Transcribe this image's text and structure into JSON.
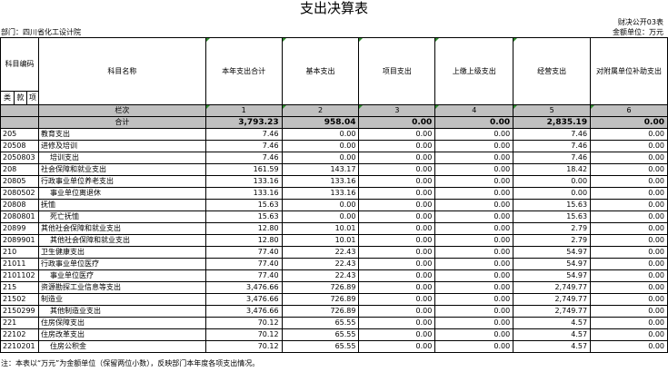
{
  "title": "支出决算表",
  "form_code": "财决公开03表",
  "unit": "金额单位：万元",
  "department": "部门：四川省化工设计院",
  "headers": {
    "code": "科目编码",
    "lei": "类",
    "kuan": "款",
    "xiang": "项",
    "name": "科目名称",
    "col1": "本年支出合计",
    "col2": "基本支出",
    "col3": "项目支出",
    "col4": "上缴上级支出",
    "col5": "经营支出",
    "col6": "对附属单位补助支出"
  },
  "index_row": {
    "label": "栏次",
    "c1": "1",
    "c2": "2",
    "c3": "3",
    "c4": "4",
    "c5": "5",
    "c6": "6"
  },
  "total_row": {
    "label": "合计",
    "c1": "3,793.23",
    "c2": "958.04",
    "c3": "0.00",
    "c4": "0.00",
    "c5": "2,835.19",
    "c6": "0.00"
  },
  "rows": [
    {
      "code": "205",
      "name": "教育支出",
      "c1": "7.46",
      "c2": "0.00",
      "c3": "0.00",
      "c4": "0.00",
      "c5": "7.46",
      "c6": "0.00"
    },
    {
      "code": "20508",
      "name": "进修及培训",
      "c1": "7.46",
      "c2": "0.00",
      "c3": "0.00",
      "c4": "0.00",
      "c5": "7.46",
      "c6": "0.00"
    },
    {
      "code": "2050803",
      "name": "培训支出",
      "c1": "7.46",
      "c2": "0.00",
      "c3": "0.00",
      "c4": "0.00",
      "c5": "7.46",
      "c6": "0.00"
    },
    {
      "code": "208",
      "name": "社会保障和就业支出",
      "c1": "161.59",
      "c2": "143.17",
      "c3": "0.00",
      "c4": "0.00",
      "c5": "18.42",
      "c6": "0.00"
    },
    {
      "code": "20805",
      "name": "行政事业单位养老支出",
      "c1": "133.16",
      "c2": "133.16",
      "c3": "0.00",
      "c4": "0.00",
      "c5": "0.00",
      "c6": "0.00"
    },
    {
      "code": "2080502",
      "name": "事业单位离退休",
      "c1": "133.16",
      "c2": "133.16",
      "c3": "0.00",
      "c4": "0.00",
      "c5": "0.00",
      "c6": "0.00"
    },
    {
      "code": "20808",
      "name": "抚恤",
      "c1": "15.63",
      "c2": "0.00",
      "c3": "0.00",
      "c4": "0.00",
      "c5": "15.63",
      "c6": "0.00"
    },
    {
      "code": "2080801",
      "name": "死亡抚恤",
      "c1": "15.63",
      "c2": "0.00",
      "c3": "0.00",
      "c4": "0.00",
      "c5": "15.63",
      "c6": "0.00"
    },
    {
      "code": "20899",
      "name": "其他社会保障和就业支出",
      "c1": "12.80",
      "c2": "10.01",
      "c3": "0.00",
      "c4": "0.00",
      "c5": "2.79",
      "c6": "0.00"
    },
    {
      "code": "2089901",
      "name": "其他社会保障和就业支出",
      "c1": "12.80",
      "c2": "10.01",
      "c3": "0.00",
      "c4": "0.00",
      "c5": "2.79",
      "c6": "0.00"
    },
    {
      "code": "210",
      "name": "卫生健康支出",
      "c1": "77.40",
      "c2": "22.43",
      "c3": "0.00",
      "c4": "0.00",
      "c5": "54.97",
      "c6": "0.00"
    },
    {
      "code": "21011",
      "name": "行政事业单位医疗",
      "c1": "77.40",
      "c2": "22.43",
      "c3": "0.00",
      "c4": "0.00",
      "c5": "54.97",
      "c6": "0.00"
    },
    {
      "code": "2101102",
      "name": "事业单位医疗",
      "c1": "77.40",
      "c2": "22.43",
      "c3": "0.00",
      "c4": "0.00",
      "c5": "54.97",
      "c6": "0.00"
    },
    {
      "code": "215",
      "name": "资源勘探工业信息等支出",
      "c1": "3,476.66",
      "c2": "726.89",
      "c3": "0.00",
      "c4": "0.00",
      "c5": "2,749.77",
      "c6": "0.00"
    },
    {
      "code": "21502",
      "name": "制造业",
      "c1": "3,476.66",
      "c2": "726.89",
      "c3": "0.00",
      "c4": "0.00",
      "c5": "2,749.77",
      "c6": "0.00"
    },
    {
      "code": "2150299",
      "name": "其他制造业支出",
      "c1": "3,476.66",
      "c2": "726.89",
      "c3": "0.00",
      "c4": "0.00",
      "c5": "2,749.77",
      "c6": "0.00"
    },
    {
      "code": "221",
      "name": "住房保障支出",
      "c1": "70.12",
      "c2": "65.55",
      "c3": "0.00",
      "c4": "0.00",
      "c5": "4.57",
      "c6": "0.00"
    },
    {
      "code": "22102",
      "name": "住房改革支出",
      "c1": "70.12",
      "c2": "65.55",
      "c3": "0.00",
      "c4": "0.00",
      "c5": "4.57",
      "c6": "0.00"
    },
    {
      "code": "2210201",
      "name": "住房公积金",
      "c1": "70.12",
      "c2": "65.55",
      "c3": "0.00",
      "c4": "0.00",
      "c5": "4.57",
      "c6": "0.00"
    }
  ],
  "footnote": "注：本表以“万元”为金额单位（保留两位小数），反映部门本年度各项支出情况。"
}
